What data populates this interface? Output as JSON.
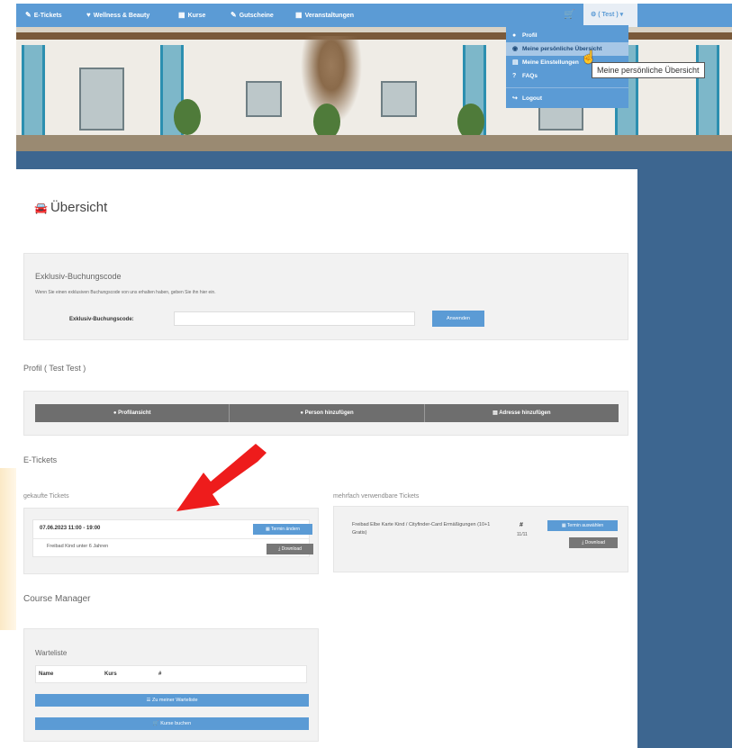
{
  "navbar": {
    "items": [
      {
        "label": "E-Tickets",
        "icon": "ticket-icon"
      },
      {
        "label": "Wellness & Beauty",
        "icon": "heart-icon"
      },
      {
        "label": "Kurse",
        "icon": "calendar-icon"
      },
      {
        "label": "Gutscheine",
        "icon": "gift-icon"
      },
      {
        "label": "Veranstaltungen",
        "icon": "building-icon"
      }
    ],
    "cart_icon": "cart-icon",
    "user_label": "( Test )",
    "user_icon": "users-icon"
  },
  "dropdown": {
    "items": [
      {
        "label": "Profil",
        "icon": "user-icon"
      },
      {
        "label": "Meine persönliche Übersicht",
        "icon": "dashboard-icon"
      },
      {
        "label": "Meine Einstellungen",
        "icon": "card-icon"
      },
      {
        "label": "FAQs",
        "icon": "question-icon"
      }
    ],
    "logout": {
      "label": "Logout",
      "icon": "logout-icon"
    },
    "tooltip": "Meine persönliche Übersicht"
  },
  "page": {
    "title": "Übersicht",
    "title_icon": "dashboard-icon"
  },
  "exclusive_code": {
    "title": "Exklusiv-Buchungscode",
    "description": "Wenn Sie einen exklusiven Buchungscode von uns erhalten haben, geben Sie ihn hier ein.",
    "label": "Exklusiv-Buchungscode:",
    "input_value": "",
    "button_label": "Anwenden"
  },
  "profile": {
    "heading": "Profil ( Test Test )",
    "buttons": [
      {
        "label": "Profilansicht",
        "icon": "user-icon"
      },
      {
        "label": "Person hinzufügen",
        "icon": "person-plus-icon"
      },
      {
        "label": "Adresse hinzufügen",
        "icon": "address-icon"
      }
    ]
  },
  "etickets": {
    "heading": "E-Tickets",
    "booked": {
      "heading": "gekaufte Tickets",
      "date": "07.06.2023 11:00 - 19:00",
      "name": "Freibad Kind unter 6 Jahren",
      "change_label": "Termin ändern",
      "download_label": "Download"
    },
    "multi": {
      "heading": "mehrfach verwendbare Tickets",
      "name": "Freibad Elbe Karte Kind / Cityfinder-Card Ermäßigungen (10+1 Gratis)",
      "count": "11/11",
      "book_label": "Termin auswählen",
      "download_label": "Download"
    }
  },
  "course_manager": {
    "heading": "Course Manager",
    "waitlist_title": "Warteliste",
    "columns": [
      "Name",
      "Kurs",
      "#"
    ],
    "btn_waitlist": "Zu meiner Warteliste",
    "btn_book": "Kurse buchen"
  },
  "colors": {
    "primary": "#5b9bd5",
    "dark_sidebar": "#3d6690",
    "button_gray": "#777777",
    "arrow_red": "#ee1c1c"
  }
}
